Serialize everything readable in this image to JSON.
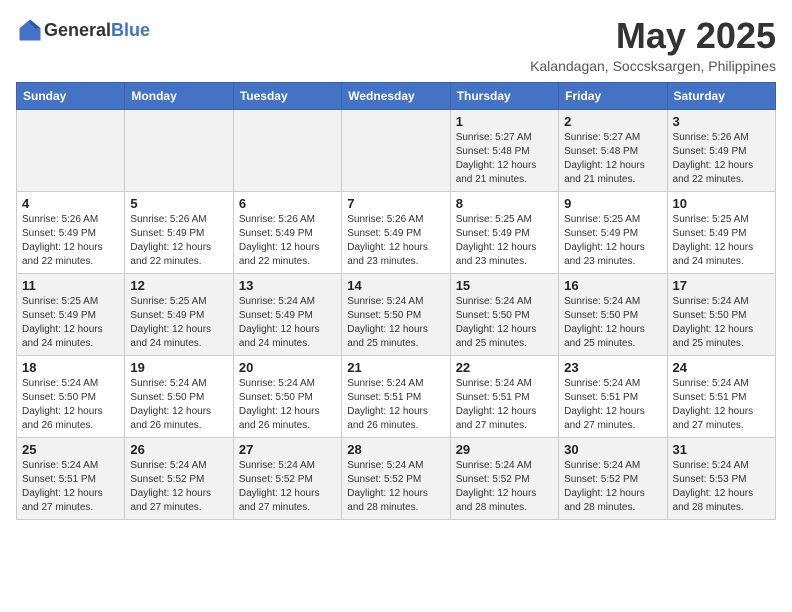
{
  "header": {
    "logo_general": "General",
    "logo_blue": "Blue",
    "title": "May 2025",
    "subtitle": "Kalandagan, Soccsksargen, Philippines"
  },
  "weekdays": [
    "Sunday",
    "Monday",
    "Tuesday",
    "Wednesday",
    "Thursday",
    "Friday",
    "Saturday"
  ],
  "weeks": [
    [
      {
        "day": "",
        "info": ""
      },
      {
        "day": "",
        "info": ""
      },
      {
        "day": "",
        "info": ""
      },
      {
        "day": "",
        "info": ""
      },
      {
        "day": "1",
        "info": "Sunrise: 5:27 AM\nSunset: 5:48 PM\nDaylight: 12 hours\nand 21 minutes."
      },
      {
        "day": "2",
        "info": "Sunrise: 5:27 AM\nSunset: 5:48 PM\nDaylight: 12 hours\nand 21 minutes."
      },
      {
        "day": "3",
        "info": "Sunrise: 5:26 AM\nSunset: 5:49 PM\nDaylight: 12 hours\nand 22 minutes."
      }
    ],
    [
      {
        "day": "4",
        "info": "Sunrise: 5:26 AM\nSunset: 5:49 PM\nDaylight: 12 hours\nand 22 minutes."
      },
      {
        "day": "5",
        "info": "Sunrise: 5:26 AM\nSunset: 5:49 PM\nDaylight: 12 hours\nand 22 minutes."
      },
      {
        "day": "6",
        "info": "Sunrise: 5:26 AM\nSunset: 5:49 PM\nDaylight: 12 hours\nand 22 minutes."
      },
      {
        "day": "7",
        "info": "Sunrise: 5:26 AM\nSunset: 5:49 PM\nDaylight: 12 hours\nand 23 minutes."
      },
      {
        "day": "8",
        "info": "Sunrise: 5:25 AM\nSunset: 5:49 PM\nDaylight: 12 hours\nand 23 minutes."
      },
      {
        "day": "9",
        "info": "Sunrise: 5:25 AM\nSunset: 5:49 PM\nDaylight: 12 hours\nand 23 minutes."
      },
      {
        "day": "10",
        "info": "Sunrise: 5:25 AM\nSunset: 5:49 PM\nDaylight: 12 hours\nand 24 minutes."
      }
    ],
    [
      {
        "day": "11",
        "info": "Sunrise: 5:25 AM\nSunset: 5:49 PM\nDaylight: 12 hours\nand 24 minutes."
      },
      {
        "day": "12",
        "info": "Sunrise: 5:25 AM\nSunset: 5:49 PM\nDaylight: 12 hours\nand 24 minutes."
      },
      {
        "day": "13",
        "info": "Sunrise: 5:24 AM\nSunset: 5:49 PM\nDaylight: 12 hours\nand 24 minutes."
      },
      {
        "day": "14",
        "info": "Sunrise: 5:24 AM\nSunset: 5:50 PM\nDaylight: 12 hours\nand 25 minutes."
      },
      {
        "day": "15",
        "info": "Sunrise: 5:24 AM\nSunset: 5:50 PM\nDaylight: 12 hours\nand 25 minutes."
      },
      {
        "day": "16",
        "info": "Sunrise: 5:24 AM\nSunset: 5:50 PM\nDaylight: 12 hours\nand 25 minutes."
      },
      {
        "day": "17",
        "info": "Sunrise: 5:24 AM\nSunset: 5:50 PM\nDaylight: 12 hours\nand 25 minutes."
      }
    ],
    [
      {
        "day": "18",
        "info": "Sunrise: 5:24 AM\nSunset: 5:50 PM\nDaylight: 12 hours\nand 26 minutes."
      },
      {
        "day": "19",
        "info": "Sunrise: 5:24 AM\nSunset: 5:50 PM\nDaylight: 12 hours\nand 26 minutes."
      },
      {
        "day": "20",
        "info": "Sunrise: 5:24 AM\nSunset: 5:50 PM\nDaylight: 12 hours\nand 26 minutes."
      },
      {
        "day": "21",
        "info": "Sunrise: 5:24 AM\nSunset: 5:51 PM\nDaylight: 12 hours\nand 26 minutes."
      },
      {
        "day": "22",
        "info": "Sunrise: 5:24 AM\nSunset: 5:51 PM\nDaylight: 12 hours\nand 27 minutes."
      },
      {
        "day": "23",
        "info": "Sunrise: 5:24 AM\nSunset: 5:51 PM\nDaylight: 12 hours\nand 27 minutes."
      },
      {
        "day": "24",
        "info": "Sunrise: 5:24 AM\nSunset: 5:51 PM\nDaylight: 12 hours\nand 27 minutes."
      }
    ],
    [
      {
        "day": "25",
        "info": "Sunrise: 5:24 AM\nSunset: 5:51 PM\nDaylight: 12 hours\nand 27 minutes."
      },
      {
        "day": "26",
        "info": "Sunrise: 5:24 AM\nSunset: 5:52 PM\nDaylight: 12 hours\nand 27 minutes."
      },
      {
        "day": "27",
        "info": "Sunrise: 5:24 AM\nSunset: 5:52 PM\nDaylight: 12 hours\nand 27 minutes."
      },
      {
        "day": "28",
        "info": "Sunrise: 5:24 AM\nSunset: 5:52 PM\nDaylight: 12 hours\nand 28 minutes."
      },
      {
        "day": "29",
        "info": "Sunrise: 5:24 AM\nSunset: 5:52 PM\nDaylight: 12 hours\nand 28 minutes."
      },
      {
        "day": "30",
        "info": "Sunrise: 5:24 AM\nSunset: 5:52 PM\nDaylight: 12 hours\nand 28 minutes."
      },
      {
        "day": "31",
        "info": "Sunrise: 5:24 AM\nSunset: 5:53 PM\nDaylight: 12 hours\nand 28 minutes."
      }
    ]
  ]
}
